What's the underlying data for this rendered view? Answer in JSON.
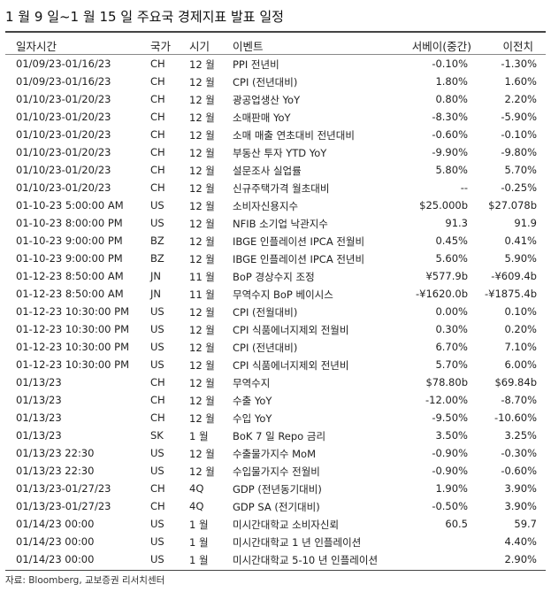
{
  "title": "1 월 9 일~1 월 15 일 주요국 경제지표 발표 일정",
  "headers": {
    "datetime": "일자시간",
    "country": "국가",
    "period": "시기",
    "event": "이벤트",
    "estimate": "서베이(중간)",
    "prior": "이전치"
  },
  "rows": [
    {
      "datetime": "01/09/23-01/16/23",
      "country": "CH",
      "period": "12 월",
      "event": "PPI 전년비",
      "estimate": "-0.10%",
      "prior": "-1.30%"
    },
    {
      "datetime": "01/09/23-01/16/23",
      "country": "CH",
      "period": "12 월",
      "event": "CPI (전년대비)",
      "estimate": "1.80%",
      "prior": "1.60%"
    },
    {
      "datetime": "01/10/23-01/20/23",
      "country": "CH",
      "period": "12 월",
      "event": "광공업생산 YoY",
      "estimate": "0.80%",
      "prior": "2.20%"
    },
    {
      "datetime": "01/10/23-01/20/23",
      "country": "CH",
      "period": "12 월",
      "event": "소매판매 YoY",
      "estimate": "-8.30%",
      "prior": "-5.90%"
    },
    {
      "datetime": "01/10/23-01/20/23",
      "country": "CH",
      "period": "12 월",
      "event": "소매 매출 연초대비 전년대비",
      "estimate": "-0.60%",
      "prior": "-0.10%"
    },
    {
      "datetime": "01/10/23-01/20/23",
      "country": "CH",
      "period": "12 월",
      "event": "부동산 투자 YTD YoY",
      "estimate": "-9.90%",
      "prior": "-9.80%"
    },
    {
      "datetime": "01/10/23-01/20/23",
      "country": "CH",
      "period": "12 월",
      "event": "설문조사 실업률",
      "estimate": "5.80%",
      "prior": "5.70%"
    },
    {
      "datetime": "01/10/23-01/20/23",
      "country": "CH",
      "period": "12 월",
      "event": "신규주택가격 월초대비",
      "estimate": "--",
      "prior": "-0.25%"
    },
    {
      "datetime": "01-10-23    5:00:00 AM",
      "country": "US",
      "period": "12 월",
      "event": "소비자신용지수",
      "estimate": "$25.000b",
      "prior": "$27.078b"
    },
    {
      "datetime": "01-10-23    8:00:00 PM",
      "country": "US",
      "period": "12 월",
      "event": "NFIB 소기업 낙관지수",
      "estimate": "91.3",
      "prior": "91.9"
    },
    {
      "datetime": "01-10-23    9:00:00 PM",
      "country": "BZ",
      "period": "12 월",
      "event": "IBGE 인플레이션 IPCA 전월비",
      "estimate": "0.45%",
      "prior": "0.41%"
    },
    {
      "datetime": "01-10-23    9:00:00 PM",
      "country": "BZ",
      "period": "12 월",
      "event": "IBGE 인플레이션 IPCA 전년비",
      "estimate": "5.60%",
      "prior": "5.90%"
    },
    {
      "datetime": "01-12-23    8:50:00 AM",
      "country": "JN",
      "period": "11 월",
      "event": "BoP 경상수지 조정",
      "estimate": "¥577.9b",
      "prior": "-¥609.4b"
    },
    {
      "datetime": "01-12-23    8:50:00 AM",
      "country": "JN",
      "period": "11 월",
      "event": "무역수지 BoP 베이시스",
      "estimate": "-¥1620.0b",
      "prior": "-¥1875.4b"
    },
    {
      "datetime": "01-12-23    10:30:00 PM",
      "country": "US",
      "period": "12 월",
      "event": "CPI (전월대비)",
      "estimate": "0.00%",
      "prior": "0.10%"
    },
    {
      "datetime": "01-12-23    10:30:00 PM",
      "country": "US",
      "period": "12 월",
      "event": "CPI 식품에너지제외 전월비",
      "estimate": "0.30%",
      "prior": "0.20%"
    },
    {
      "datetime": "01-12-23    10:30:00 PM",
      "country": "US",
      "period": "12 월",
      "event": "CPI (전년대비)",
      "estimate": "6.70%",
      "prior": "7.10%"
    },
    {
      "datetime": "01-12-23    10:30:00 PM",
      "country": "US",
      "period": "12 월",
      "event": "CPI 식품에너지제외 전년비",
      "estimate": "5.70%",
      "prior": "6.00%"
    },
    {
      "datetime": "01/13/23",
      "country": "CH",
      "period": "12 월",
      "event": "무역수지",
      "estimate": "$78.80b",
      "prior": "$69.84b"
    },
    {
      "datetime": "01/13/23",
      "country": "CH",
      "period": "12 월",
      "event": "수출 YoY",
      "estimate": "-12.00%",
      "prior": "-8.70%"
    },
    {
      "datetime": "01/13/23",
      "country": "CH",
      "period": "12 월",
      "event": "수입 YoY",
      "estimate": "-9.50%",
      "prior": "-10.60%"
    },
    {
      "datetime": "01/13/23",
      "country": "SK",
      "period": "1 월",
      "event": "BoK 7 일 Repo 금리",
      "estimate": "3.50%",
      "prior": "3.25%"
    },
    {
      "datetime": "01/13/23 22:30",
      "country": "US",
      "period": "12 월",
      "event": "수출물가지수 MoM",
      "estimate": "-0.90%",
      "prior": "-0.30%"
    },
    {
      "datetime": "01/13/23 22:30",
      "country": "US",
      "period": "12 월",
      "event": "수입물가지수 전월비",
      "estimate": "-0.90%",
      "prior": "-0.60%"
    },
    {
      "datetime": "01/13/23-01/27/23",
      "country": "CH",
      "period": "4Q",
      "event": "GDP (전년동기대비)",
      "estimate": "1.90%",
      "prior": "3.90%"
    },
    {
      "datetime": "01/13/23-01/27/23",
      "country": "CH",
      "period": "4Q",
      "event": "GDP SA (전기대비)",
      "estimate": "-0.50%",
      "prior": "3.90%"
    },
    {
      "datetime": "01/14/23 00:00",
      "country": "US",
      "period": "1 월",
      "event": "미시간대학교 소비자신뢰",
      "estimate": "60.5",
      "prior": "59.7"
    },
    {
      "datetime": "01/14/23 00:00",
      "country": "US",
      "period": "1 월",
      "event": "미시간대학교 1 년 인플레이션",
      "estimate": "",
      "prior": "4.40%"
    },
    {
      "datetime": "01/14/23 00:00",
      "country": "US",
      "period": "1 월",
      "event": "미시간대학교 5-10 년 인플레이션",
      "estimate": "",
      "prior": "2.90%"
    }
  ],
  "source": "자료: Bloomberg, 교보증권 리서치센터"
}
